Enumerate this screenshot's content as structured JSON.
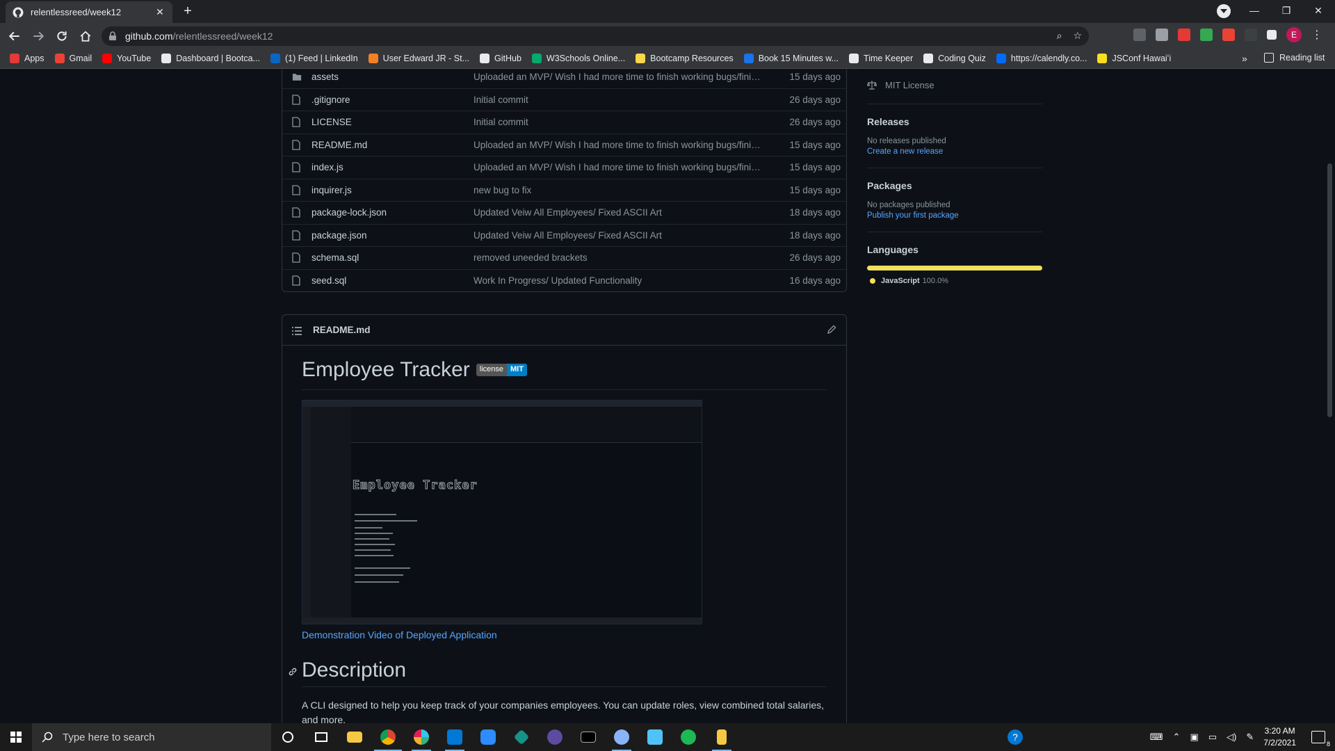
{
  "browser": {
    "tab_title": "relentlessreed/week12",
    "url_host": "github.com",
    "url_path": "/relentlessreed/week12",
    "profile_initial": "E"
  },
  "bookmarks": [
    {
      "label": "Apps",
      "color": "#e53935"
    },
    {
      "label": "Gmail",
      "color": "#ea4335"
    },
    {
      "label": "YouTube",
      "color": "#ff0000"
    },
    {
      "label": "Dashboard | Bootca...",
      "color": "#e8eaed"
    },
    {
      "label": "(1) Feed | LinkedIn",
      "color": "#0a66c2"
    },
    {
      "label": "User Edward JR - St...",
      "color": "#f48024"
    },
    {
      "label": "GitHub",
      "color": "#e8eaed"
    },
    {
      "label": "W3Schools Online...",
      "color": "#04aa6d"
    },
    {
      "label": "Bootcamp Resources",
      "color": "#f9d64a"
    },
    {
      "label": "Book 15 Minutes w...",
      "color": "#1a73e8"
    },
    {
      "label": "Time Keeper",
      "color": "#e8eaed"
    },
    {
      "label": "Coding Quiz",
      "color": "#e8eaed"
    },
    {
      "label": "https://calendly.co...",
      "color": "#006bff"
    },
    {
      "label": "JSConf Hawaiʻi",
      "color": "#f7df1e"
    }
  ],
  "reading_list": "Reading list",
  "files": [
    {
      "type": "folder",
      "name": "assets",
      "message": "Uploaded an MVP/ Wish I had more time to finish working bugs/finish t...",
      "age": "15 days ago"
    },
    {
      "type": "file",
      "name": ".gitignore",
      "message": "Initial commit",
      "age": "26 days ago"
    },
    {
      "type": "file",
      "name": "LICENSE",
      "message": "Initial commit",
      "age": "26 days ago"
    },
    {
      "type": "file",
      "name": "README.md",
      "message": "Uploaded an MVP/ Wish I had more time to finish working bugs/finish t...",
      "age": "15 days ago"
    },
    {
      "type": "file",
      "name": "index.js",
      "message": "Uploaded an MVP/ Wish I had more time to finish working bugs/finish t...",
      "age": "15 days ago"
    },
    {
      "type": "file",
      "name": "inquirer.js",
      "message": "new bug to fix",
      "age": "15 days ago"
    },
    {
      "type": "file",
      "name": "package-lock.json",
      "message": "Updated Veiw All Employees/ Fixed ASCII Art",
      "age": "18 days ago"
    },
    {
      "type": "file",
      "name": "package.json",
      "message": "Updated Veiw All Employees/ Fixed ASCII Art",
      "age": "18 days ago"
    },
    {
      "type": "file",
      "name": "schema.sql",
      "message": "removed uneeded brackets",
      "age": "26 days ago"
    },
    {
      "type": "file",
      "name": "seed.sql",
      "message": "Work In Progress/ Updated Functionality",
      "age": "16 days ago"
    }
  ],
  "readme": {
    "filename": "README.md",
    "title": "Employee Tracker",
    "badge_label": "license",
    "badge_value": "MIT",
    "screenshot_ascii": "Employee Tracker",
    "demo_link": "Demonstration Video of Deployed Application",
    "section_title": "Description",
    "description": "A CLI designed to help you keep track of your companies employees. You can update roles, view combined total salaries, and more."
  },
  "sidebar": {
    "license": "MIT License",
    "releases_title": "Releases",
    "releases_none": "No releases published",
    "releases_link": "Create a new release",
    "packages_title": "Packages",
    "packages_none": "No packages published",
    "packages_link": "Publish your first package",
    "languages_title": "Languages",
    "language_name": "JavaScript",
    "language_pct": "100.0%",
    "language_share": 100,
    "language_color": "#f1e05a"
  },
  "taskbar": {
    "search_placeholder": "Type here to search",
    "time": "3:20 AM",
    "date": "7/2/2021",
    "notification_count": "8"
  }
}
